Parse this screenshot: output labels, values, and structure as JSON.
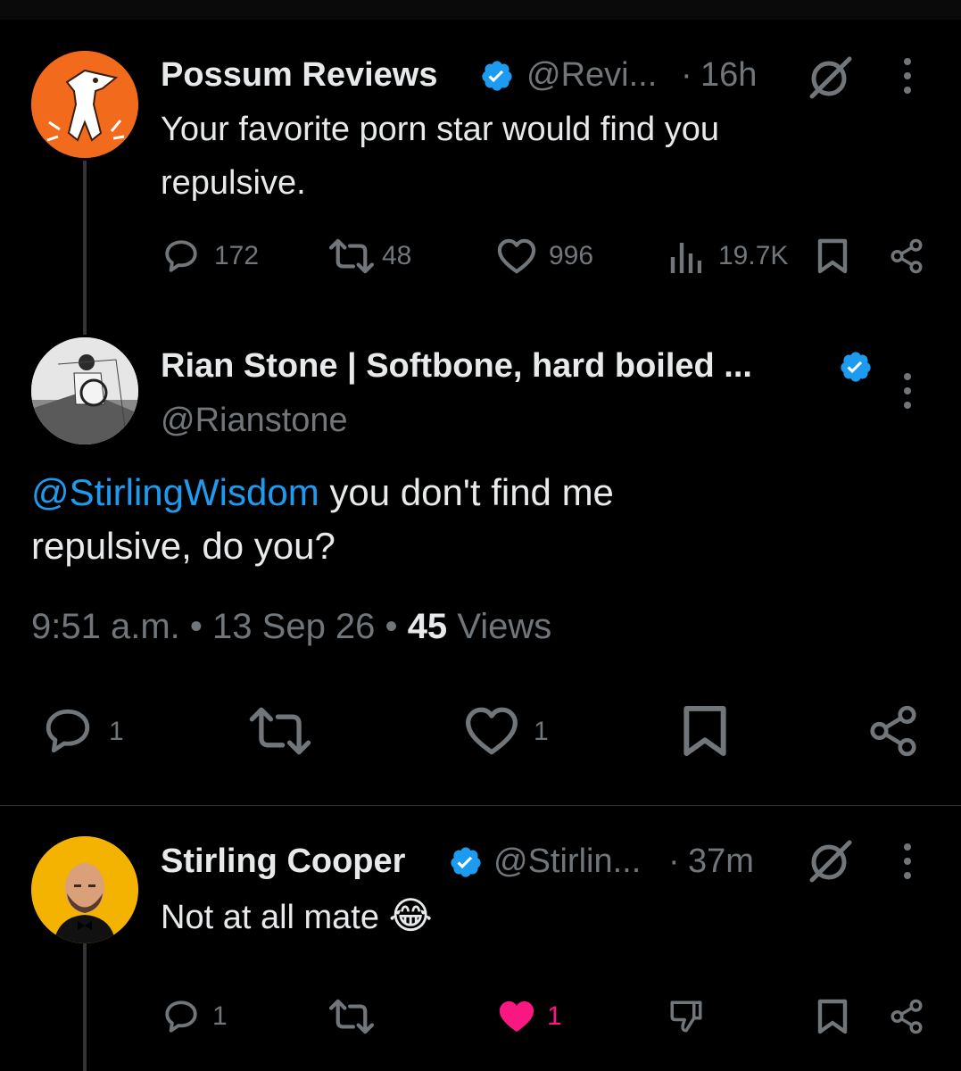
{
  "tweets": [
    {
      "name": "Possum Reviews",
      "handle": "@Revi...",
      "separator": "·",
      "time": "16h",
      "text": "Your favorite porn star would find you repulsive.",
      "replies": "172",
      "retweets": "48",
      "likes": "996",
      "views": "19.7K"
    }
  ],
  "main_tweet": {
    "name": "Rian Stone | Softbone, hard boiled ...",
    "handle": "@Rianstone",
    "mention": "@StirlingWisdom",
    "text": " you don't find me repulsive, do you?",
    "time": "9:51 a.m.",
    "dot": "•",
    "date": "13 Sep 26",
    "views_count": "45",
    "views_label": "Views",
    "replies": "1",
    "likes": "1"
  },
  "reply": {
    "name": "Stirling Cooper",
    "handle": "@Stirlin...",
    "separator": "·",
    "time": "37m",
    "text": "Not at all mate",
    "emoji": "😂",
    "replies": "1",
    "likes": "1"
  },
  "colors": {
    "background": "#000000",
    "text": "#e7e9ea",
    "muted": "#71767b",
    "link": "#1d9bf0",
    "liked": "#f91880",
    "verified": "#1d9bf0"
  },
  "icons": [
    "reply-icon",
    "retweet-icon",
    "like-icon",
    "views-icon",
    "bookmark-icon",
    "share-icon",
    "more-icon",
    "grok-icon",
    "dislike-icon",
    "verified-icon"
  ]
}
